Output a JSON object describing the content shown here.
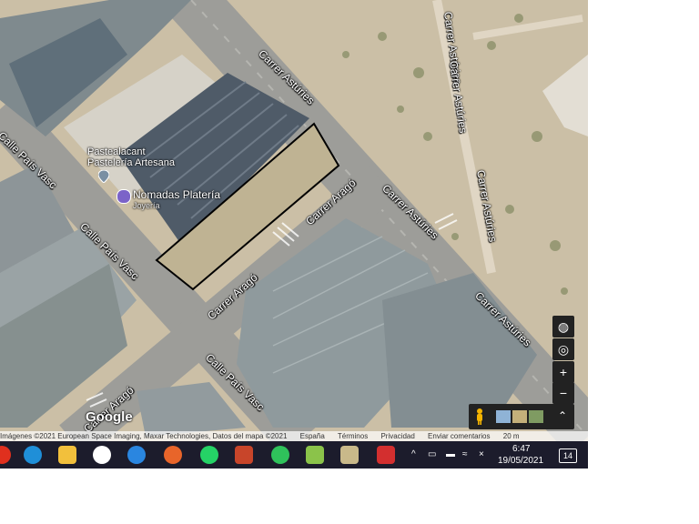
{
  "map": {
    "street_labels": {
      "astúries_top": "Carrer Astúries",
      "astúries_mid": "Carrer Astúries",
      "astúries_right1": "Carrer Astúries",
      "astúries_right2": "Carrer Astúries",
      "astúries_bottom": "Carrer Astúries",
      "arago_top": "Carrer Aragó",
      "arago_mid": "Carrer Aragó",
      "arago_bottom": "Carrer Aragó",
      "pais_vasc_left": "Calle País Vasc",
      "pais_vasc_mid": "Calle País Vasc",
      "pais_vasc_bottom": "Calle País Vasc"
    },
    "pois": {
      "pastealacant_name": "Pastealacant",
      "pastealacant_sub": "Pastelería Artesana",
      "nomadas_name": "Nomadas Platería",
      "nomadas_sub": "Joyería"
    },
    "controls": {
      "globe": "globe-icon",
      "locate": "my-location-icon",
      "zoom_in": "+",
      "zoom_out": "−",
      "pegman": "pegman-icon",
      "expand": "chevron-up-icon"
    },
    "logo": "Google",
    "attribution": {
      "imagery": "Imágenes ©2021 European Space Imaging, Maxar Technologies, Datos del mapa ©2021",
      "country": "España",
      "terms": "Términos",
      "privacy": "Privacidad",
      "feedback": "Enviar comentarios",
      "scale": "20 m"
    }
  },
  "taskbar": {
    "time": "6:47",
    "date": "19/05/2021",
    "notifications": "14",
    "apps": [
      "opera-icon",
      "edge-icon",
      "file-explorer-icon",
      "google-maps-icon",
      "internet-explorer-icon",
      "firefox-icon",
      "whatsapp-icon",
      "paint-icon",
      "wechat-icon",
      "layers-app-icon",
      "image-viewer-icon",
      "pdf-icon"
    ]
  },
  "colors": {
    "taskbar": "#1c1c2c",
    "road": "#9d9d99",
    "roof": "#8f9a9d",
    "soil": "#cbbfa6"
  }
}
